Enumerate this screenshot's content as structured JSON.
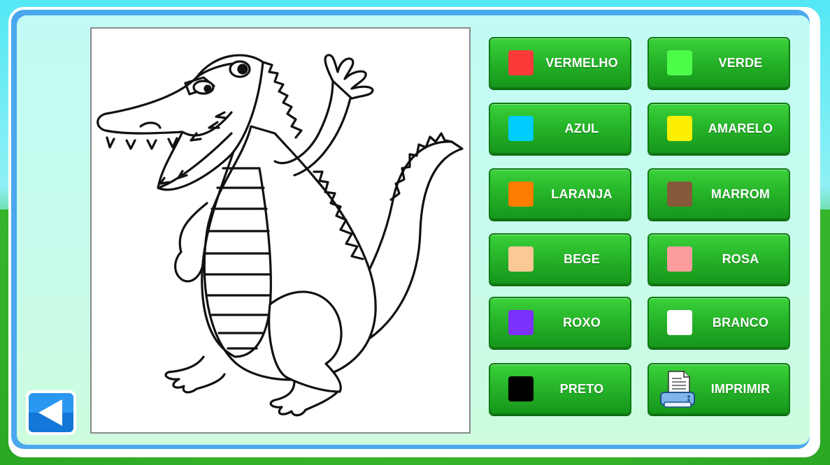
{
  "palette": {
    "buttons": [
      {
        "label": "VERMELHO",
        "color": "#fc3a3a"
      },
      {
        "label": "VERDE",
        "color": "#4efc4a"
      },
      {
        "label": "AZUL",
        "color": "#00cdfc"
      },
      {
        "label": "AMARELO",
        "color": "#fcf000"
      },
      {
        "label": "LARANJA",
        "color": "#fc7d00"
      },
      {
        "label": "MARROM",
        "color": "#845a3a"
      },
      {
        "label": "BEGE",
        "color": "#fcc896"
      },
      {
        "label": "ROSA",
        "color": "#fc9c9c"
      },
      {
        "label": "ROXO",
        "color": "#7d31fc"
      },
      {
        "label": "BRANCO",
        "color": "#ffffff"
      },
      {
        "label": "PRETO",
        "color": "#000000"
      }
    ],
    "print": {
      "label": "IMPRIMIR",
      "icon": "printer-icon"
    }
  },
  "navigation": {
    "back_icon": "back-arrow-icon"
  },
  "drawing": {
    "subject_icon": "crocodile-outline"
  }
}
